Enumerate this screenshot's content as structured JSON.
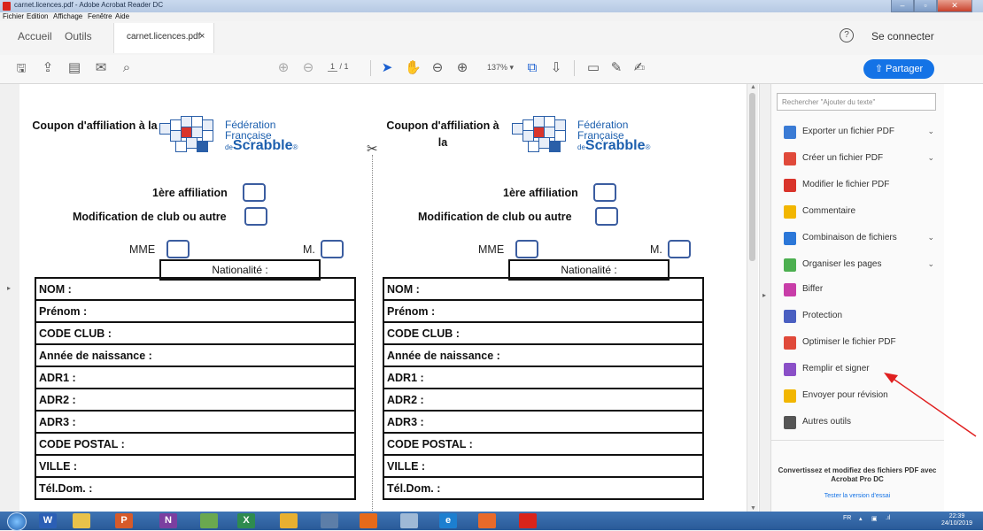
{
  "window": {
    "title": "carnet.licences.pdf - Adobe Acrobat Reader DC"
  },
  "menubar": {
    "items": [
      "Fichier",
      "Edition",
      "Affichage",
      "Fenêtre",
      "Aide"
    ]
  },
  "tabs": {
    "home": "Accueil",
    "tools": "Outils",
    "document": "carnet.licences.pdf",
    "close": "×"
  },
  "header": {
    "help": "?",
    "connect": "Se connecter"
  },
  "toolbar": {
    "page_current": "1",
    "page_total": "/ 1",
    "zoom": "137%",
    "share_label": "Partager",
    "icons": [
      "save-icon",
      "upload-icon",
      "print-icon",
      "email-icon",
      "search-icon",
      "page-up-icon",
      "page-down-icon",
      "select-arrow-icon",
      "hand-icon",
      "zoom-out-icon",
      "zoom-in-icon",
      "fit-page-icon",
      "scroll-mode-icon",
      "comment-icon",
      "pen-icon",
      "sign-icon"
    ]
  },
  "coupon": {
    "title": "Coupon d'affiliation à la",
    "title_truncated": "Coupon d'affiliation à la",
    "logo": {
      "line1": "Fédération",
      "line2": "Française",
      "line3_prefix": "de",
      "line3": "Scrabble",
      "mark": "®"
    },
    "first_affiliation": "1ère affiliation",
    "modification": "Modification de club ou autre",
    "mme": "MME",
    "m": "M.",
    "nationality": "Nationalité :",
    "fields": [
      "NOM :",
      "Prénom :",
      "CODE CLUB :",
      "Année de naissance :",
      "ADR1 :",
      "ADR2 :",
      "ADR3 :",
      "CODE POSTAL :",
      "VILLE :",
      "Tél.Dom. :"
    ]
  },
  "cut_icon": "✂",
  "tools_pane": {
    "search_placeholder": "Rechercher \"Ajouter du texte\"",
    "items": [
      {
        "label": "Exporter un fichier PDF",
        "has_chevron": true,
        "color": "#3a7bd5"
      },
      {
        "label": "Créer un fichier PDF",
        "has_chevron": true,
        "color": "#e0493a"
      },
      {
        "label": "Modifier le fichier PDF",
        "has_chevron": false,
        "color": "#d9342b"
      },
      {
        "label": "Commentaire",
        "has_chevron": false,
        "color": "#f2b600"
      },
      {
        "label": "Combinaison de fichiers",
        "has_chevron": true,
        "color": "#2b77d8"
      },
      {
        "label": "Organiser les pages",
        "has_chevron": true,
        "color": "#4caf50"
      },
      {
        "label": "Biffer",
        "has_chevron": false,
        "color": "#c83da8"
      },
      {
        "label": "Protection",
        "has_chevron": false,
        "color": "#4a5fc1"
      },
      {
        "label": "Optimiser le fichier PDF",
        "has_chevron": false,
        "color": "#e0493a"
      },
      {
        "label": "Remplir et signer",
        "has_chevron": false,
        "color": "#8a4fc7"
      },
      {
        "label": "Envoyer pour révision",
        "has_chevron": false,
        "color": "#f2b600"
      },
      {
        "label": "Autres outils",
        "has_chevron": false,
        "color": "#555555"
      }
    ],
    "chevron": "⌄",
    "promo": "Convertissez et modifiez des fichiers PDF avec Acrobat Pro DC",
    "trial_link": "Tester la version d'essai"
  },
  "taskbar": {
    "apps": [
      {
        "name": "word-icon",
        "glyph": "W",
        "color": "#2b5fb5"
      },
      {
        "name": "explorer-icon",
        "glyph": "",
        "color": "#e9c24a"
      },
      {
        "name": "powerpoint-icon",
        "glyph": "P",
        "color": "#d65a2a"
      },
      {
        "name": "onenote-icon",
        "glyph": "N",
        "color": "#7b3fa0"
      },
      {
        "name": "paint-icon",
        "glyph": "",
        "color": "#6aa84f"
      },
      {
        "name": "excel-icon",
        "glyph": "X",
        "color": "#2e8b4f"
      },
      {
        "name": "snipping-icon",
        "glyph": "",
        "color": "#e8b030"
      },
      {
        "name": "calculator-icon",
        "glyph": "",
        "color": "#5d7ea8"
      },
      {
        "name": "firefox-icon",
        "glyph": "",
        "color": "#e66a1a"
      },
      {
        "name": "document-icon",
        "glyph": "",
        "color": "#9fb9d6"
      },
      {
        "name": "ie-icon",
        "glyph": "e",
        "color": "#1c7fd0"
      },
      {
        "name": "mail-icon",
        "glyph": "",
        "color": "#e86a2a"
      },
      {
        "name": "acrobat-icon",
        "glyph": "",
        "color": "#d9241b"
      }
    ],
    "language": "FR",
    "time": "22:39",
    "date": "24/10/2019"
  },
  "annotation_color": "#e02020"
}
